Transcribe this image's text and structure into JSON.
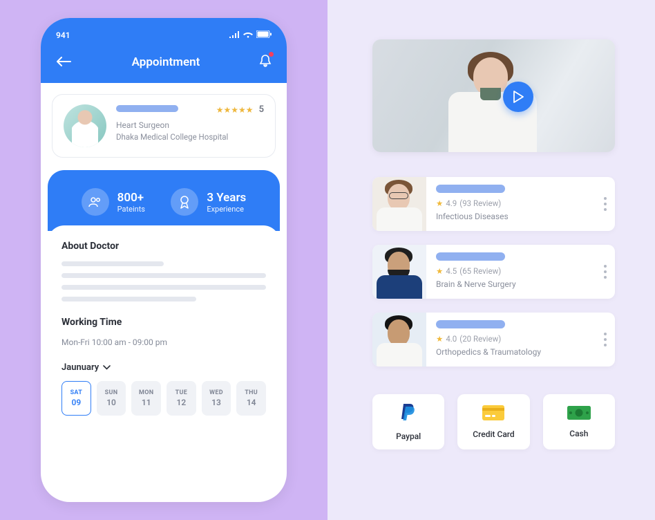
{
  "phone": {
    "status_time": "941",
    "title": "Appointment",
    "doctor": {
      "role": "Heart Surgeon",
      "hospital": "Dhaka Medical College Hospital",
      "rating_stars": "★★★★★",
      "rating_value": "5"
    },
    "stats": {
      "patients_value": "800+",
      "patients_label": "Pateints",
      "experience_value": "3 Years",
      "experience_label": "Experience"
    },
    "about_heading": "About Doctor",
    "working_heading": "Working Time",
    "working_hours": "Mon-Fri 10:00 am - 09:00 pm",
    "month": "Jaunuary",
    "dates": [
      {
        "dw": "SAT",
        "dn": "09"
      },
      {
        "dw": "SUN",
        "dn": "10"
      },
      {
        "dw": "MON",
        "dn": "11"
      },
      {
        "dw": "TUE",
        "dn": "12"
      },
      {
        "dw": "WED",
        "dn": "13"
      },
      {
        "dw": "THU",
        "dn": "14"
      }
    ]
  },
  "doctors": [
    {
      "rating": "4.9",
      "reviews": "(93 Review)",
      "specialty": "Infectious Diseases"
    },
    {
      "rating": "4.5",
      "reviews": "(65 Review)",
      "specialty": "Brain & Nerve Surgery"
    },
    {
      "rating": "4.0",
      "reviews": "(20 Review)",
      "specialty": "Orthopedics & Traumatology"
    }
  ],
  "payments": {
    "paypal": "Paypal",
    "credit_card": "Credit Card",
    "cash": "Cash"
  }
}
